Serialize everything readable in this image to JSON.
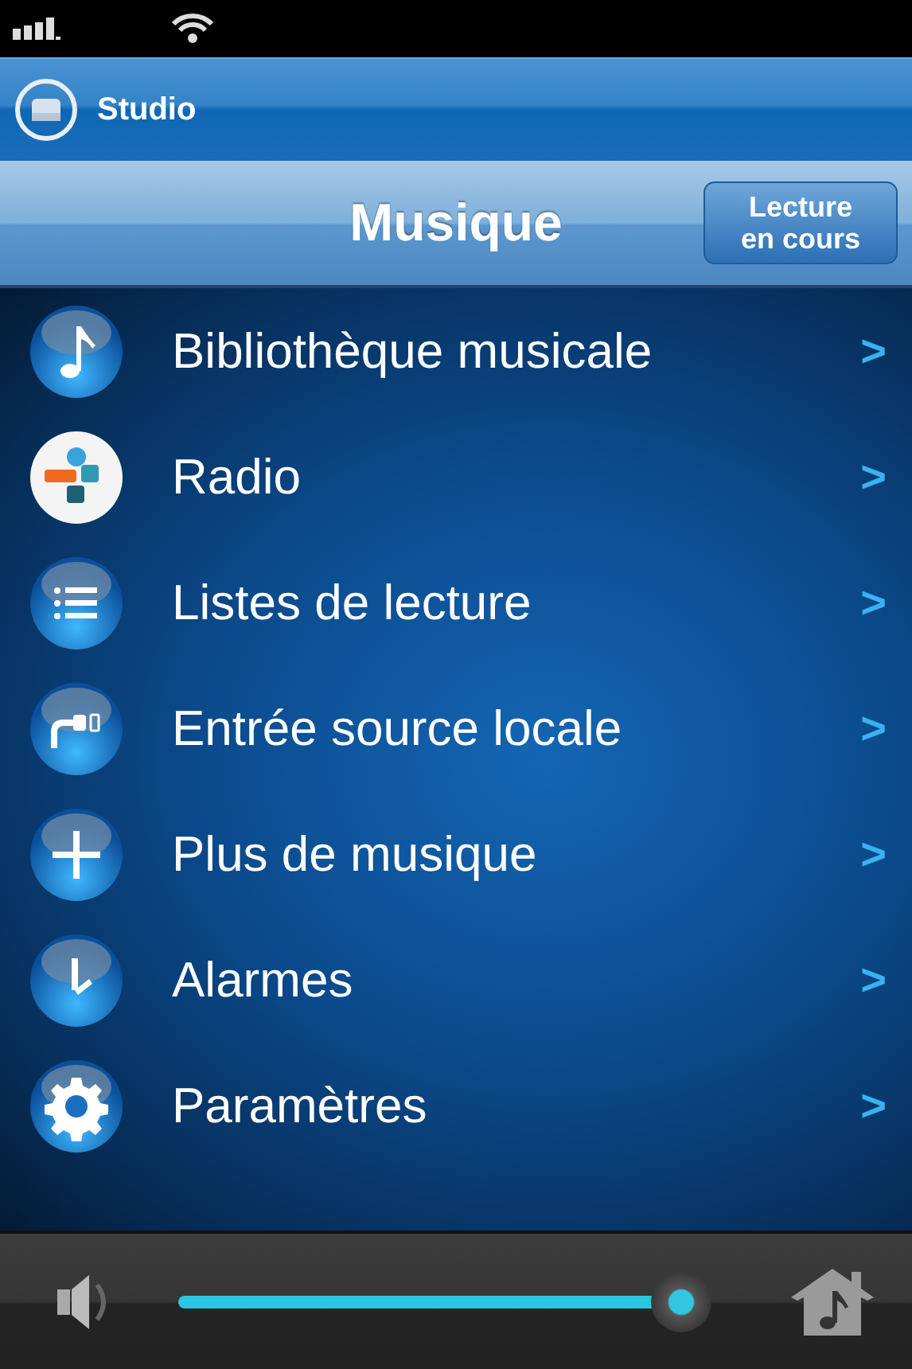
{
  "zone": {
    "title": "Studio"
  },
  "nav": {
    "title": "Musique",
    "button": "Lecture\nen cours"
  },
  "menu": [
    {
      "kind": "library",
      "label": "Bibliothèque musicale",
      "chevron": ">"
    },
    {
      "kind": "radio",
      "label": "Radio",
      "chevron": ">"
    },
    {
      "kind": "playlists",
      "label": "Listes de lecture",
      "chevron": ">"
    },
    {
      "kind": "input",
      "label": "Entrée source locale",
      "chevron": ">"
    },
    {
      "kind": "more",
      "label": "Plus de musique",
      "chevron": ">"
    },
    {
      "kind": "alarms",
      "label": "Alarmes",
      "chevron": ">"
    },
    {
      "kind": "settings",
      "label": "Paramètres",
      "chevron": ">"
    }
  ],
  "volume": {
    "level": 0.95
  }
}
